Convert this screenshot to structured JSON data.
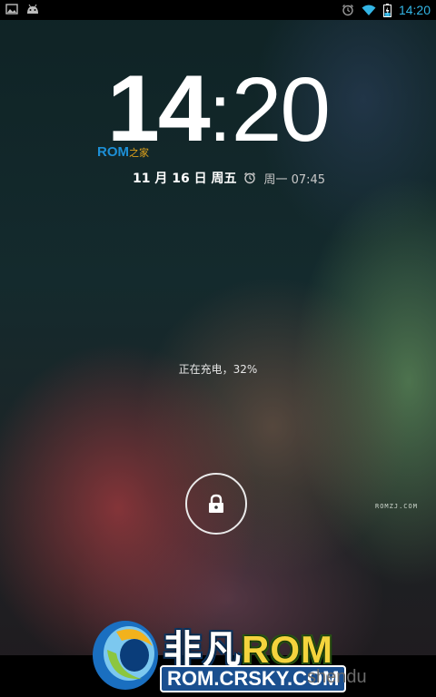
{
  "status_bar": {
    "time": "14:20",
    "left_icons": [
      "gallery-notification-icon",
      "android-notification-icon"
    ],
    "right_icons": [
      "alarm-icon",
      "wifi-icon",
      "battery-charging-icon"
    ]
  },
  "clock": {
    "hour": "14",
    "separator": ":",
    "minute": "20"
  },
  "watermark_badge": {
    "part1": "ROM",
    "part2": "之家"
  },
  "date": "11 月 16 日 周五",
  "next_alarm": "周一 07:45",
  "charging_status": "正在充电，32%",
  "unlock": {
    "icon": "lock-icon"
  },
  "watermark_small": "ROMZJ.COM",
  "bottom_watermark": {
    "title_cn": "非凡",
    "title_rom": "ROM",
    "url": "ROM.CRSKY.COM",
    "shendu": "shendu"
  },
  "colors": {
    "status_time": "#33b5e5",
    "accent_blue": "#1d8fd6",
    "accent_yellow": "#f4d43d"
  }
}
